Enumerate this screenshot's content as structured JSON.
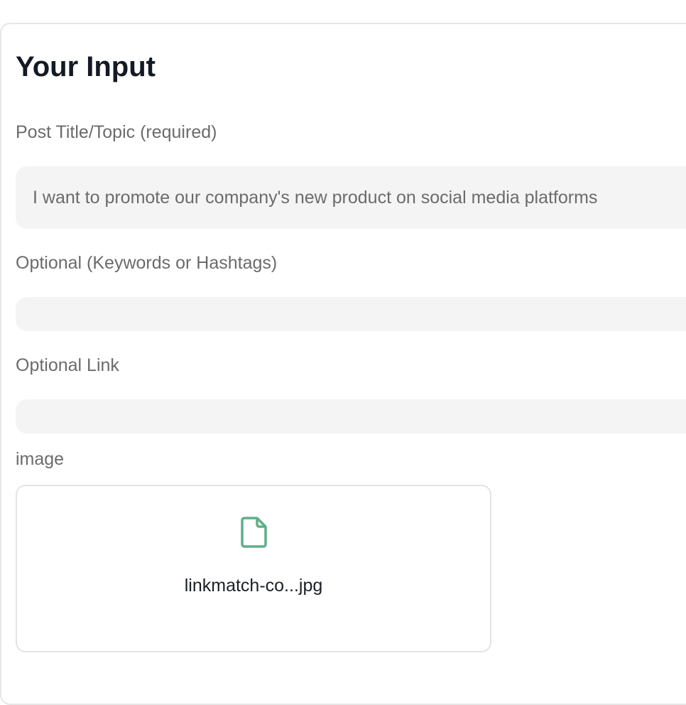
{
  "panel": {
    "title": "Your Input"
  },
  "fields": {
    "post_title": {
      "label": "Post Title/Topic (required)",
      "value": "I want to promote our company's new product on social media platforms"
    },
    "keywords": {
      "label": "Optional (Keywords or Hashtags)",
      "value": ""
    },
    "link": {
      "label": "Optional Link",
      "value": ""
    },
    "image": {
      "label": "image",
      "file_name": "linkmatch-co...jpg",
      "icon": "file-icon"
    }
  },
  "colors": {
    "icon_accent": "#5fae88",
    "input_bg": "#f4f4f4",
    "label_text": "#6b6b6b",
    "title_text": "#141a24"
  }
}
